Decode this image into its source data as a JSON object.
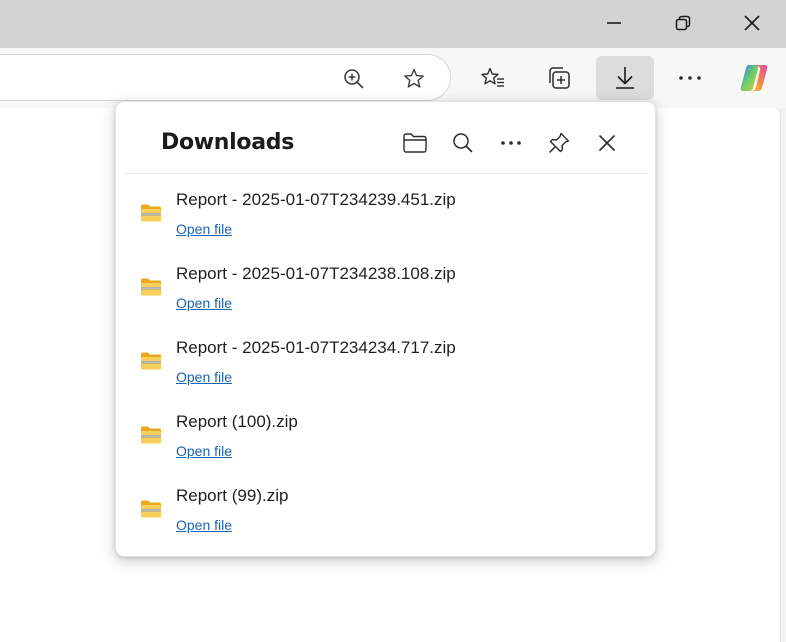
{
  "flyout": {
    "title": "Downloads",
    "icons": [
      "folder-icon",
      "search-icon",
      "more-icon",
      "pin-icon",
      "close-icon"
    ]
  },
  "downloads": [
    {
      "filename": "Report - 2025-01-07T234239.451.zip",
      "action": "Open file"
    },
    {
      "filename": "Report - 2025-01-07T234238.108.zip",
      "action": "Open file"
    },
    {
      "filename": "Report - 2025-01-07T234234.717.zip",
      "action": "Open file"
    },
    {
      "filename": "Report (100).zip",
      "action": "Open file"
    },
    {
      "filename": "Report (99).zip",
      "action": "Open file"
    }
  ],
  "colors": {
    "titlebar": "#d3d3d3",
    "toolbar": "#f7f7f7",
    "link": "#1a63ad",
    "folder": "#f4c542",
    "active_button": "#dcdcdc"
  }
}
